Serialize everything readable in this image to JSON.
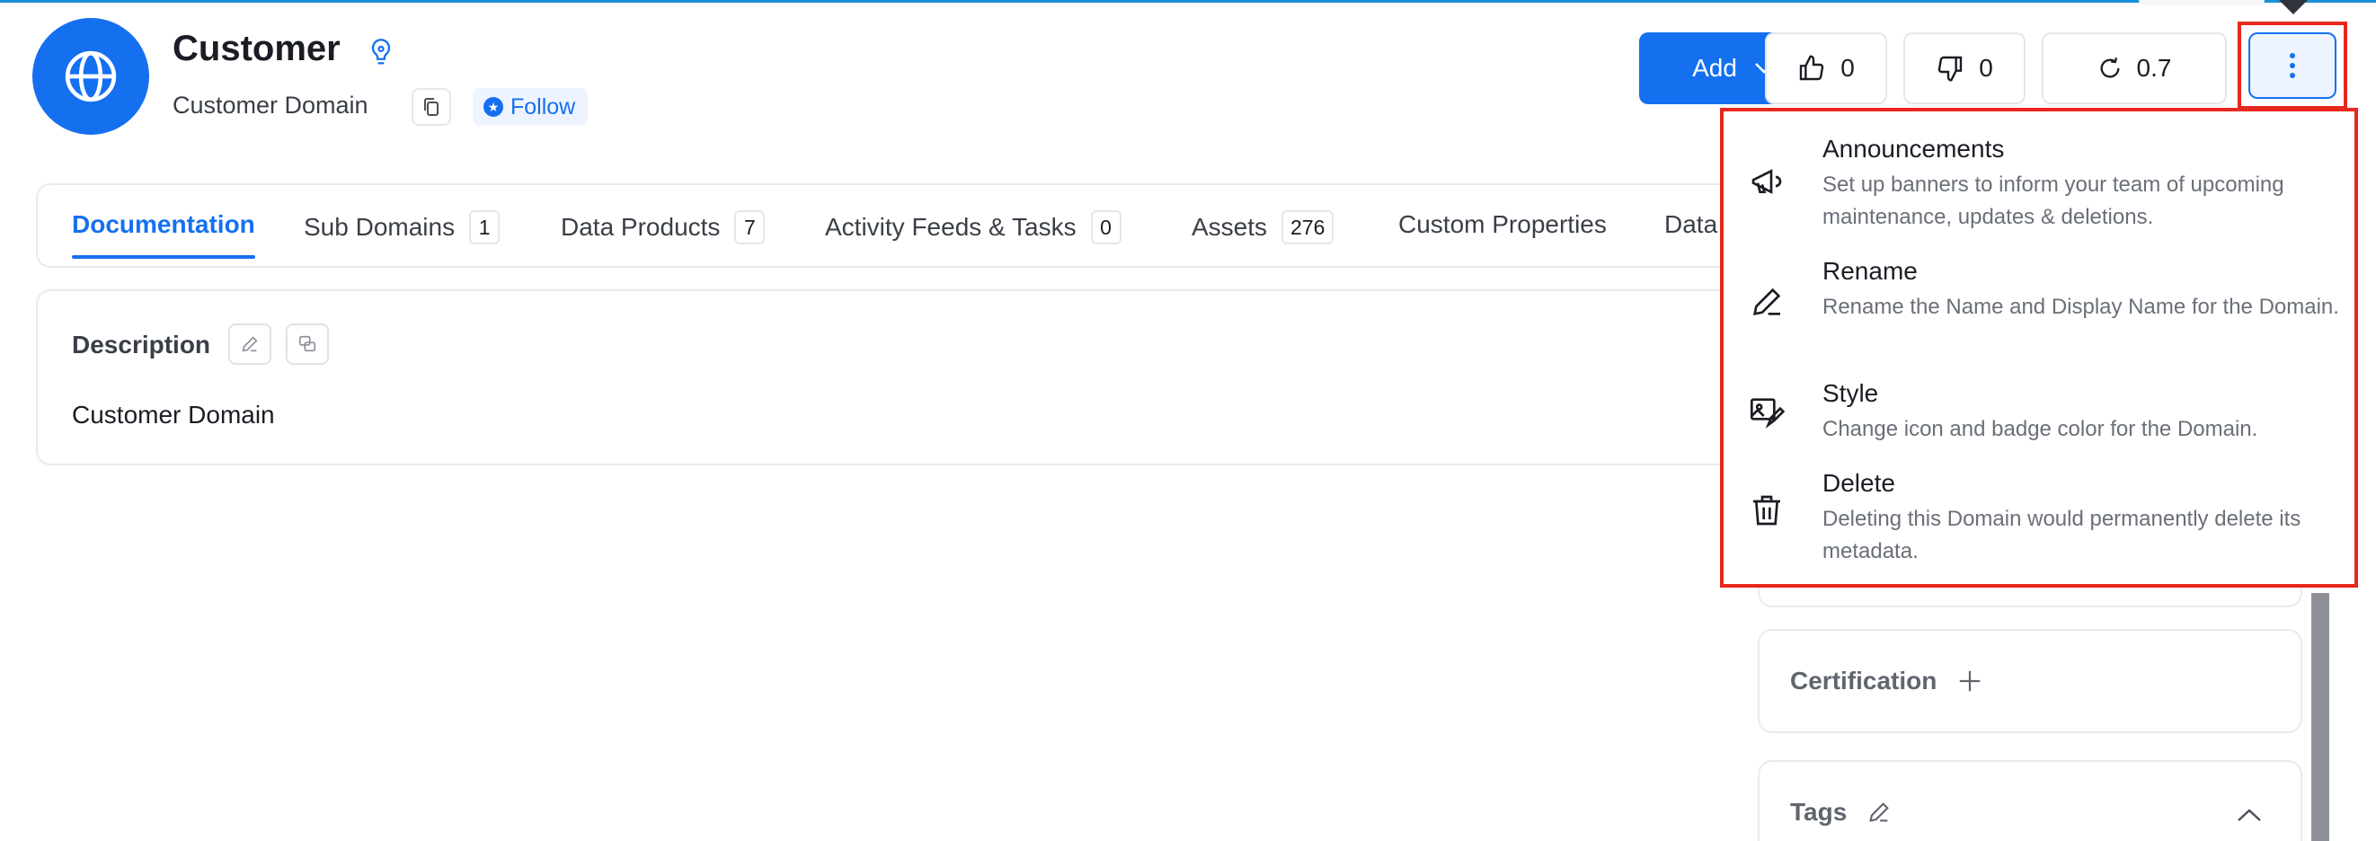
{
  "header": {
    "title": "Customer",
    "subtitle": "Customer Domain",
    "follow_label": "Follow"
  },
  "actions": {
    "add_label": "Add",
    "upvotes": "0",
    "downvotes": "0",
    "version": "0.7"
  },
  "tabs": [
    {
      "label": "Documentation",
      "active": true
    },
    {
      "label": "Sub Domains",
      "count": "1"
    },
    {
      "label": "Data Products",
      "count": "7"
    },
    {
      "label": "Activity Feeds & Tasks",
      "count": "0"
    },
    {
      "label": "Assets",
      "count": "276"
    },
    {
      "label": "Custom Properties"
    },
    {
      "label": "Data"
    }
  ],
  "description": {
    "label": "Description",
    "text": "Customer Domain"
  },
  "side_panels": {
    "certification": "Certification",
    "tags": "Tags"
  },
  "menu": {
    "items": [
      {
        "title": "Announcements",
        "desc": "Set up banners to inform your team of upcoming maintenance, updates & deletions.",
        "icon": "megaphone-icon"
      },
      {
        "title": "Rename",
        "desc": "Rename the Name and Display Name for the Domain.",
        "icon": "pencil-icon"
      },
      {
        "title": "Style",
        "desc": "Change icon and badge color for the Domain.",
        "icon": "image-edit-icon"
      },
      {
        "title": "Delete",
        "desc": "Deleting this Domain would permanently delete its metadata.",
        "icon": "trash-icon"
      }
    ]
  },
  "colors": {
    "accent": "#1570ef",
    "highlight": "#e8281d"
  }
}
